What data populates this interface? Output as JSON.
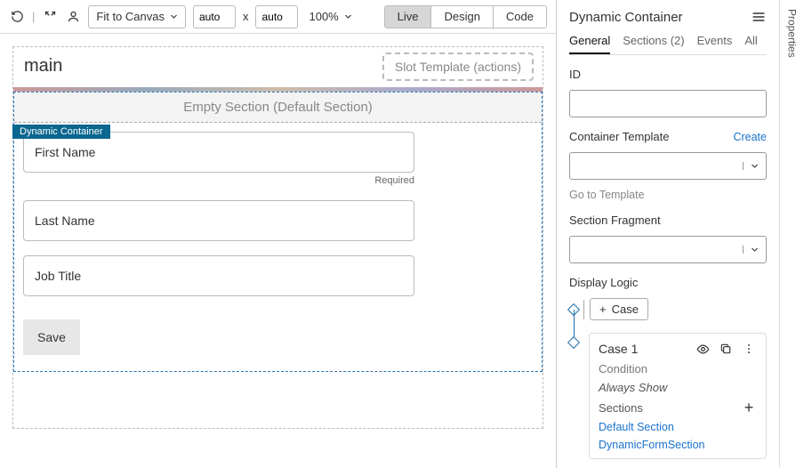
{
  "toolbar": {
    "fit_label": "Fit to Canvas",
    "width_value": "auto",
    "height_value": "auto",
    "x_label": "x",
    "zoom_label": "100%",
    "modes": {
      "live": "Live",
      "design": "Design",
      "code": "Code",
      "active": "live"
    }
  },
  "canvas": {
    "page_title": "main",
    "slot_template_label": "Slot Template (actions)",
    "badge_label": "Dynamic Container",
    "empty_section_label": "Empty Section (Default Section)",
    "fields": {
      "first_name_ph": "First Name",
      "required_hint": "Required",
      "last_name_ph": "Last Name",
      "job_title_ph": "Job Title"
    },
    "save_label": "Save"
  },
  "props": {
    "panel_title": "Dynamic Container",
    "tabs": {
      "general": "General",
      "sections": "Sections (2)",
      "events": "Events",
      "all": "All"
    },
    "id_label": "ID",
    "id_value": "",
    "container_template_label": "Container Template",
    "create_label": "Create",
    "goto_template_label": "Go to Template",
    "section_fragment_label": "Section Fragment",
    "display_logic_label": "Display Logic",
    "case_button_label": "Case",
    "case1": {
      "title": "Case 1",
      "condition_label": "Condition",
      "condition_value": "Always Show",
      "sections_label": "Sections",
      "section_links": {
        "default": "Default Section",
        "dynamic": "DynamicFormSection"
      }
    }
  },
  "rail": {
    "label": "Properties"
  }
}
